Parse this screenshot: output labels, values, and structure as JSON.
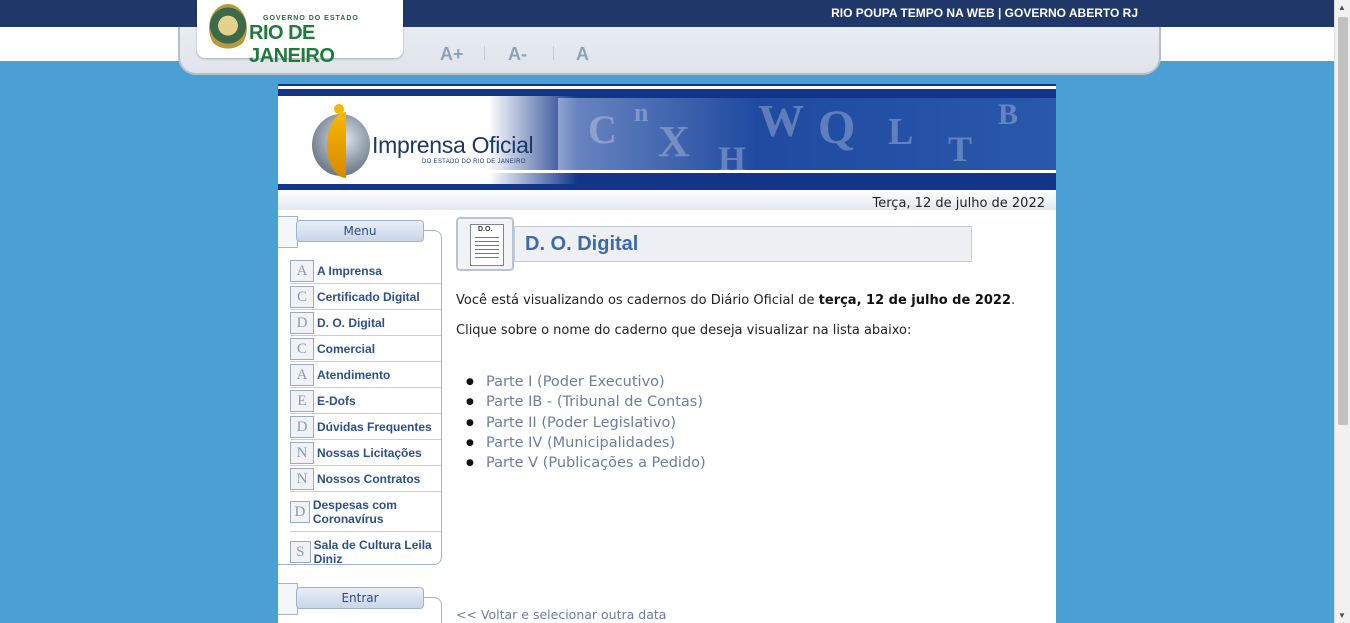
{
  "gov_header": {
    "logo_small": "GOVERNO DO ESTADO",
    "logo_big": "RIO DE JANEIRO",
    "links": "RIO POUPA TEMPO NA WEB | GOVERNO ABERTO RJ",
    "font_increase": "A+",
    "font_decrease": "A-",
    "font_reset": "A"
  },
  "banner": {
    "title": "Imprensa Oficial",
    "subtitle": "DO ESTADO DO RIO DE JANEIRO"
  },
  "date": "Terça, 12 de julho de 2022",
  "menu": {
    "header": "Menu",
    "items": [
      {
        "icon": "A",
        "label": "A Imprensa"
      },
      {
        "icon": "C",
        "label": "Certificado Digital"
      },
      {
        "icon": "D",
        "label": "D. O. Digital"
      },
      {
        "icon": "C",
        "label": "Comercial"
      },
      {
        "icon": "A",
        "label": "Atendimento"
      },
      {
        "icon": "E",
        "label": "E-Dofs"
      },
      {
        "icon": "D",
        "label": "Dúvidas Frequentes"
      },
      {
        "icon": "N",
        "label": "Nossas Licitações"
      },
      {
        "icon": "N",
        "label": "Nossos Contratos"
      },
      {
        "icon": "D",
        "label": "Despesas com Coronavírus"
      },
      {
        "icon": "S",
        "label": "Sala de Cultura Leila Diniz"
      }
    ],
    "login_header": "Entrar"
  },
  "content": {
    "icon_label": "D.O.",
    "title": "D. O. Digital",
    "intro_prefix": "Você está visualizando os cadernos do Diário Oficial de",
    "intro_date": "terça, 12 de julho de 2022",
    "intro_suffix": ".",
    "instruction": "Clique sobre o nome do caderno que deseja visualizar na lista abaixo:",
    "cadernos": [
      "Parte I (Poder Executivo)",
      "Parte IB - (Tribunal de Contas)",
      "Parte II (Poder Legislativo)",
      "Parte IV (Municipalidades)",
      "Parte V (Publicações a Pedido)"
    ],
    "back_link": "<< Voltar e selecionar outra data"
  }
}
